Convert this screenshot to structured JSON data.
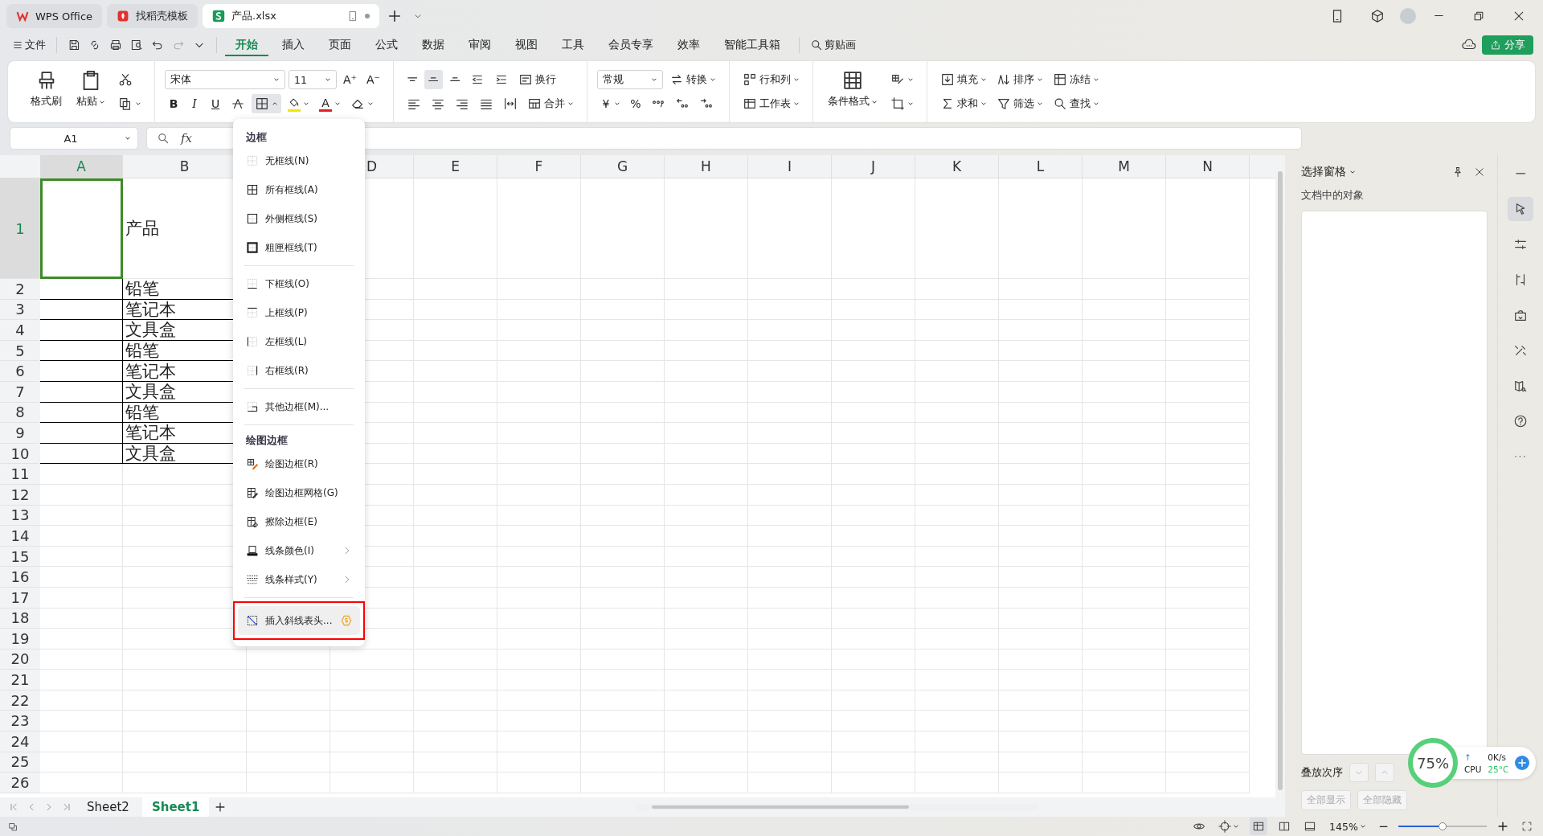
{
  "title_tabs": [
    {
      "label": "WPS Office",
      "kind": "wps",
      "selected": false
    },
    {
      "label": "找稻壳模板",
      "kind": "docer",
      "selected": false
    },
    {
      "label": "产品.xlsx",
      "kind": "sheet",
      "selected": true
    }
  ],
  "menu_bar": {
    "file": "文件",
    "tabs": [
      {
        "label": "开始",
        "selected": true
      },
      {
        "label": "插入",
        "selected": false
      },
      {
        "label": "页面",
        "selected": false
      },
      {
        "label": "公式",
        "selected": false
      },
      {
        "label": "数据",
        "selected": false
      },
      {
        "label": "审阅",
        "selected": false
      },
      {
        "label": "视图",
        "selected": false
      },
      {
        "label": "工具",
        "selected": false
      },
      {
        "label": "会员专享",
        "selected": false
      },
      {
        "label": "效率",
        "selected": false
      },
      {
        "label": "智能工具箱",
        "selected": false
      }
    ],
    "search": "剪贴画",
    "share": "分享"
  },
  "ribbon": {
    "groups": [
      {
        "columns": [
          [
            {
              "kind": "brush",
              "label": "格式刷",
              "large": true
            }
          ],
          [
            {
              "kind": "clipboard",
              "label": "粘贴",
              "large": true,
              "dropdown": true
            }
          ],
          [
            {
              "kind": "scissors"
            },
            {
              "kind": "copy",
              "dropdown": true
            }
          ]
        ]
      },
      {
        "rows": [
          [
            {
              "kind": "font-select",
              "value": "宋体"
            },
            {
              "kind": "size-select",
              "value": "11"
            },
            {
              "kind": "text",
              "text": "A⁺"
            },
            {
              "kind": "text",
              "text": "A⁻"
            }
          ],
          [
            {
              "kind": "bold",
              "text": "B"
            },
            {
              "kind": "italic",
              "text": "I"
            },
            {
              "kind": "underline",
              "text": "U"
            },
            {
              "kind": "strike"
            },
            {
              "kind": "grid",
              "selected": true,
              "open": true
            },
            {
              "kind": "bucket",
              "color": "#f2e600",
              "dropdown": true
            },
            {
              "kind": "font-color",
              "text": "A",
              "color": "#e02020",
              "dropdown": true
            },
            {
              "kind": "eraser",
              "dropdown": true
            }
          ]
        ]
      },
      {
        "rows": [
          [
            {
              "kind": "align-top"
            },
            {
              "kind": "align-middle",
              "selected": true
            },
            {
              "kind": "align-bottom"
            },
            {
              "kind": "outdent"
            },
            {
              "kind": "indent"
            },
            {
              "kind": "wrap",
              "label": "换行"
            }
          ],
          [
            {
              "kind": "align-left"
            },
            {
              "kind": "align-center"
            },
            {
              "kind": "align-right"
            },
            {
              "kind": "justify"
            },
            {
              "kind": "distribute"
            },
            {
              "kind": "merge",
              "label": "合并",
              "dropdown": true
            }
          ]
        ]
      },
      {
        "rows": [
          [
            {
              "kind": "format-select",
              "value": "常规"
            },
            {
              "kind": "convert",
              "label": "转换",
              "dropdown": true
            }
          ],
          [
            {
              "kind": "text",
              "text": "¥",
              "dropdown": true
            },
            {
              "kind": "text",
              "text": "%"
            },
            {
              "kind": "thousands"
            },
            {
              "kind": "dec-more"
            },
            {
              "kind": "dec-less"
            }
          ]
        ]
      },
      {
        "rows": [
          [
            {
              "kind": "rows-cols",
              "label": "行和列",
              "dropdown": true
            }
          ],
          [
            {
              "kind": "sheet",
              "label": "工作表",
              "dropdown": true
            }
          ]
        ]
      },
      {
        "columns": [
          [
            {
              "kind": "cond-format",
              "label": "条件格式",
              "large": true,
              "dropdown": true
            }
          ],
          [
            {
              "kind": "cell-style",
              "dropdown": true
            },
            {
              "kind": "crop-border",
              "dropdown": true
            }
          ]
        ]
      },
      {
        "rows": [
          [
            {
              "kind": "fill",
              "label": "填充",
              "dropdown": true
            },
            {
              "kind": "sort",
              "label": "排序",
              "dropdown": true
            },
            {
              "kind": "freeze",
              "label": "冻结",
              "dropdown": true
            }
          ],
          [
            {
              "kind": "sum",
              "label": "求和",
              "dropdown": true
            },
            {
              "kind": "filter",
              "label": "筛选",
              "dropdown": true
            },
            {
              "kind": "find",
              "label": "查找",
              "dropdown": true
            }
          ]
        ]
      }
    ]
  },
  "formula_bar": {
    "name_box": "A1",
    "fx": "fx"
  },
  "sheet": {
    "columns": [
      {
        "label": "A",
        "selected": true
      },
      {
        "label": "B",
        "selected": false
      },
      {
        "label": "D",
        "selected": false
      },
      {
        "label": "E",
        "selected": false
      },
      {
        "label": "F",
        "selected": false
      },
      {
        "label": "G",
        "selected": false
      },
      {
        "label": "H",
        "selected": false
      },
      {
        "label": "I",
        "selected": false
      },
      {
        "label": "J",
        "selected": false
      },
      {
        "label": "K",
        "selected": false
      },
      {
        "label": "L",
        "selected": false
      },
      {
        "label": "M",
        "selected": false
      },
      {
        "label": "N",
        "selected": false
      }
    ],
    "rows": [
      {
        "header": "1",
        "selected": true,
        "bordered": false,
        "B": "产品"
      },
      {
        "header": "2",
        "selected": false,
        "bordered": true,
        "B": "铅笔"
      },
      {
        "header": "3",
        "selected": false,
        "bordered": true,
        "B": "笔记本"
      },
      {
        "header": "4",
        "selected": false,
        "bordered": true,
        "B": "文具盒"
      },
      {
        "header": "5",
        "selected": false,
        "bordered": true,
        "B": "铅笔"
      },
      {
        "header": "6",
        "selected": false,
        "bordered": true,
        "B": "笔记本"
      },
      {
        "header": "7",
        "selected": false,
        "bordered": true,
        "B": "文具盒"
      },
      {
        "header": "8",
        "selected": false,
        "bordered": true,
        "B": "铅笔"
      },
      {
        "header": "9",
        "selected": false,
        "bordered": true,
        "B": "笔记本"
      },
      {
        "header": "10",
        "selected": false,
        "bordered": true,
        "B": "文具盒"
      },
      {
        "header": "11",
        "selected": false,
        "bordered": false
      },
      {
        "header": "12",
        "selected": false,
        "bordered": false
      },
      {
        "header": "13",
        "selected": false,
        "bordered": false
      },
      {
        "header": "14",
        "selected": false,
        "bordered": false
      },
      {
        "header": "15",
        "selected": false,
        "bordered": false
      },
      {
        "header": "16",
        "selected": false,
        "bordered": false
      },
      {
        "header": "17",
        "selected": false,
        "bordered": false
      },
      {
        "header": "18",
        "selected": false,
        "bordered": false
      },
      {
        "header": "19",
        "selected": false,
        "bordered": false
      },
      {
        "header": "20",
        "selected": false,
        "bordered": false
      },
      {
        "header": "21",
        "selected": false,
        "bordered": false
      },
      {
        "header": "22",
        "selected": false,
        "bordered": false
      },
      {
        "header": "23",
        "selected": false,
        "bordered": false
      },
      {
        "header": "24",
        "selected": false,
        "bordered": false
      },
      {
        "header": "25",
        "selected": false,
        "bordered": false
      },
      {
        "header": "26",
        "selected": false,
        "bordered": false
      }
    ]
  },
  "border_menu": {
    "groups": [
      {
        "title": "边框",
        "items": [
          {
            "label": "无框线(N)",
            "kind": "none"
          },
          {
            "label": "所有框线(A)",
            "kind": "all"
          },
          {
            "label": "外侧框线(S)",
            "kind": "outside"
          },
          {
            "label": "粗匣框线(T)",
            "kind": "thick"
          }
        ]
      },
      {
        "items": [
          {
            "label": "下框线(O)",
            "kind": "bottom"
          },
          {
            "label": "上框线(P)",
            "kind": "top"
          },
          {
            "label": "左框线(L)",
            "kind": "left"
          },
          {
            "label": "右框线(R)",
            "kind": "right"
          }
        ]
      },
      {
        "items": [
          {
            "label": "其他边框(M)...",
            "kind": "other"
          }
        ]
      },
      {
        "title": "绘图边框",
        "items": [
          {
            "label": "绘图边框(R)",
            "kind": "draw"
          },
          {
            "label": "绘图边框网格(G)",
            "kind": "draw-grid"
          },
          {
            "label": "擦除边框(E)",
            "kind": "erase"
          },
          {
            "label": "线条颜色(I)",
            "kind": "color",
            "submenu": true
          },
          {
            "label": "线条样式(Y)",
            "kind": "style",
            "submenu": true
          }
        ]
      },
      {
        "items": [
          {
            "label": "插入斜线表头...",
            "kind": "diagonal",
            "premium": true,
            "hovered": true,
            "outlined": true
          }
        ]
      }
    ]
  },
  "selection_pane": {
    "title": "选择窗格",
    "subtitle": "文档中的对象",
    "order_label": "叠放次序",
    "buttons": [
      {
        "label": "全部显示",
        "disabled": true
      },
      {
        "label": "全部隐藏",
        "disabled": true
      }
    ]
  },
  "side_toolbar": [
    {
      "kind": "minimize",
      "selected": false
    },
    {
      "kind": "cursor",
      "selected": true
    },
    {
      "kind": "sliders",
      "selected": false
    },
    {
      "kind": "swap",
      "selected": false
    },
    {
      "kind": "bag",
      "selected": false
    },
    {
      "kind": "tools",
      "selected": false
    },
    {
      "kind": "book",
      "selected": false
    },
    {
      "kind": "help",
      "selected": false
    },
    {
      "kind": "more",
      "selected": false
    }
  ],
  "sheet_tabs": [
    {
      "label": "Sheet2",
      "selected": false
    },
    {
      "label": "Sheet1",
      "selected": true
    }
  ],
  "status_bar": {
    "zoom": "145%",
    "zoom_slider": {
      "level": 0.5
    }
  },
  "speed_widget": {
    "percent": "75%",
    "arrow": "↑",
    "speed": "0K/s",
    "cpu_label": "CPU",
    "temperature": "25°C"
  }
}
